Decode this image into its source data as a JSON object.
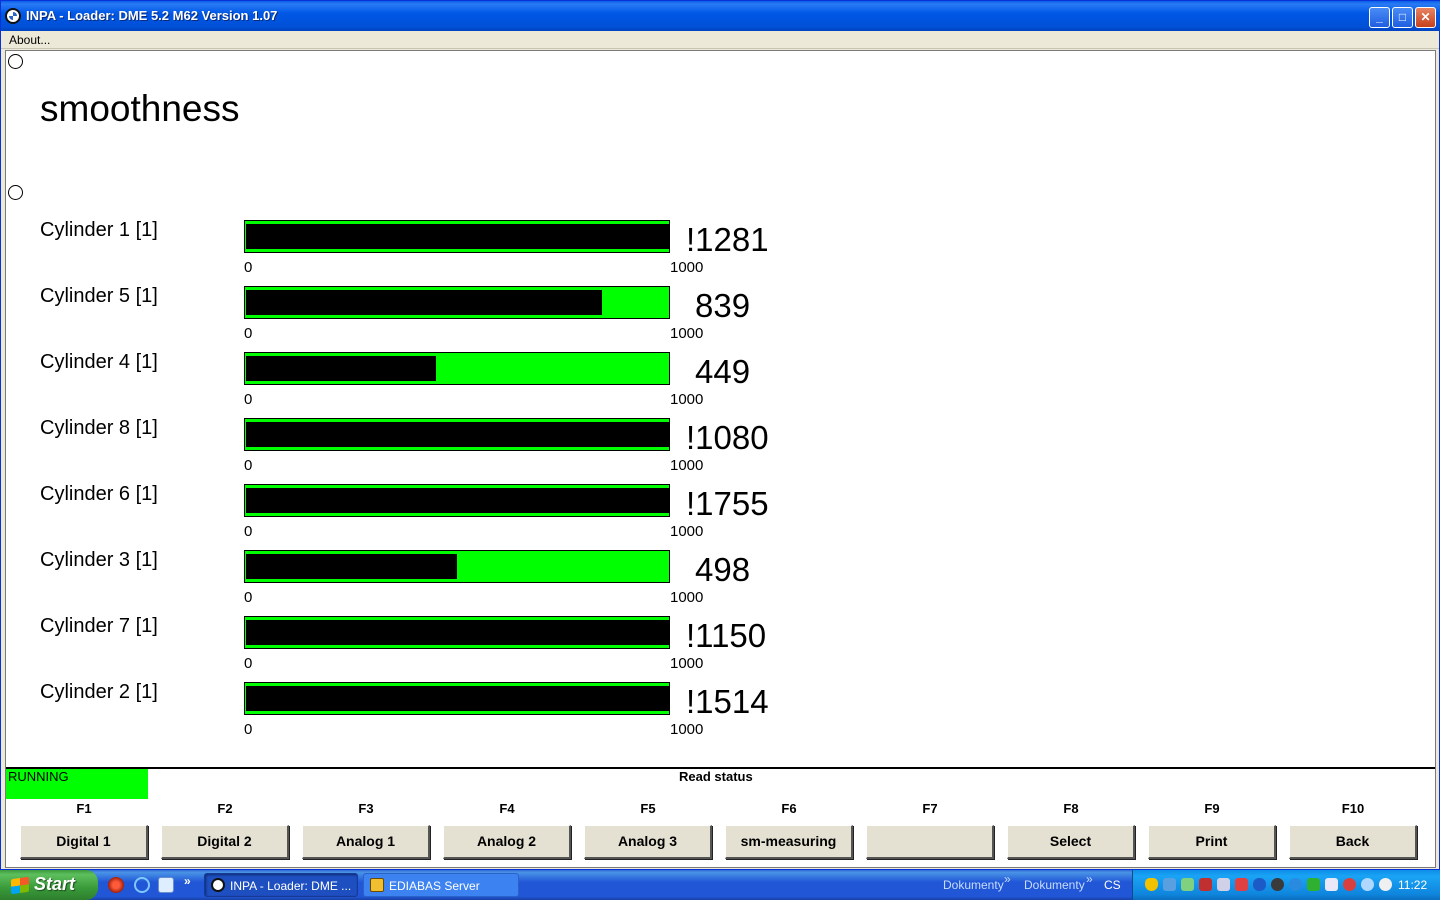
{
  "window": {
    "title": "INPA - Loader:  DME 5.2 M62 Version 1.07",
    "minimize_icon": "minimize-icon",
    "maximize_icon": "maximize-icon",
    "close_icon": "close-icon"
  },
  "menu": {
    "about": "About..."
  },
  "screen": {
    "title": "smoothness",
    "rows": [
      {
        "label": "Cylinder 1 [1]",
        "value": "!1281",
        "fraction": 1.0,
        "min": "0",
        "max": "1000"
      },
      {
        "label": "Cylinder 5 [1]",
        "value": "839",
        "fraction": 0.839,
        "min": "0",
        "max": "1000"
      },
      {
        "label": "Cylinder 4 [1]",
        "value": "449",
        "fraction": 0.449,
        "min": "0",
        "max": "1000"
      },
      {
        "label": "Cylinder 8 [1]",
        "value": "!1080",
        "fraction": 1.0,
        "min": "0",
        "max": "1000"
      },
      {
        "label": "Cylinder 6 [1]",
        "value": "!1755",
        "fraction": 1.0,
        "min": "0",
        "max": "1000"
      },
      {
        "label": "Cylinder 3 [1]",
        "value": "498",
        "fraction": 0.498,
        "min": "0",
        "max": "1000"
      },
      {
        "label": "Cylinder 7 [1]",
        "value": "!1150",
        "fraction": 1.0,
        "min": "0",
        "max": "1000"
      },
      {
        "label": "Cylinder 2 [1]",
        "value": "!1514",
        "fraction": 1.0,
        "min": "0",
        "max": "1000"
      }
    ],
    "colors": {
      "bar_background": "#00ff00",
      "bar_fill": "#000000"
    }
  },
  "status": {
    "running": "RUNNING",
    "read_status": "Read status",
    "running_color": "#00ff00"
  },
  "fkeys": [
    {
      "key": "F1",
      "label": "Digital 1"
    },
    {
      "key": "F2",
      "label": "Digital 2"
    },
    {
      "key": "F3",
      "label": "Analog 1"
    },
    {
      "key": "F4",
      "label": "Analog 2"
    },
    {
      "key": "F5",
      "label": "Analog 3"
    },
    {
      "key": "F6",
      "label": "sm-measuring"
    },
    {
      "key": "F7",
      "label": ""
    },
    {
      "key": "F8",
      "label": "Select"
    },
    {
      "key": "F9",
      "label": "Print"
    },
    {
      "key": "F10",
      "label": "Back"
    }
  ],
  "taskbar": {
    "start": "Start",
    "quicklaunch_more": "»",
    "tasks": [
      {
        "label": "INPA - Loader: DME ...",
        "icon": "inpa-icon"
      },
      {
        "label": "EDIABAS Server",
        "icon": "ediabas-icon"
      }
    ],
    "toolbar_1": "Dokumenty",
    "toolbar_2": "Dokumenty",
    "toolbar_sep": "»",
    "language": "CS",
    "clock": "11:22"
  }
}
